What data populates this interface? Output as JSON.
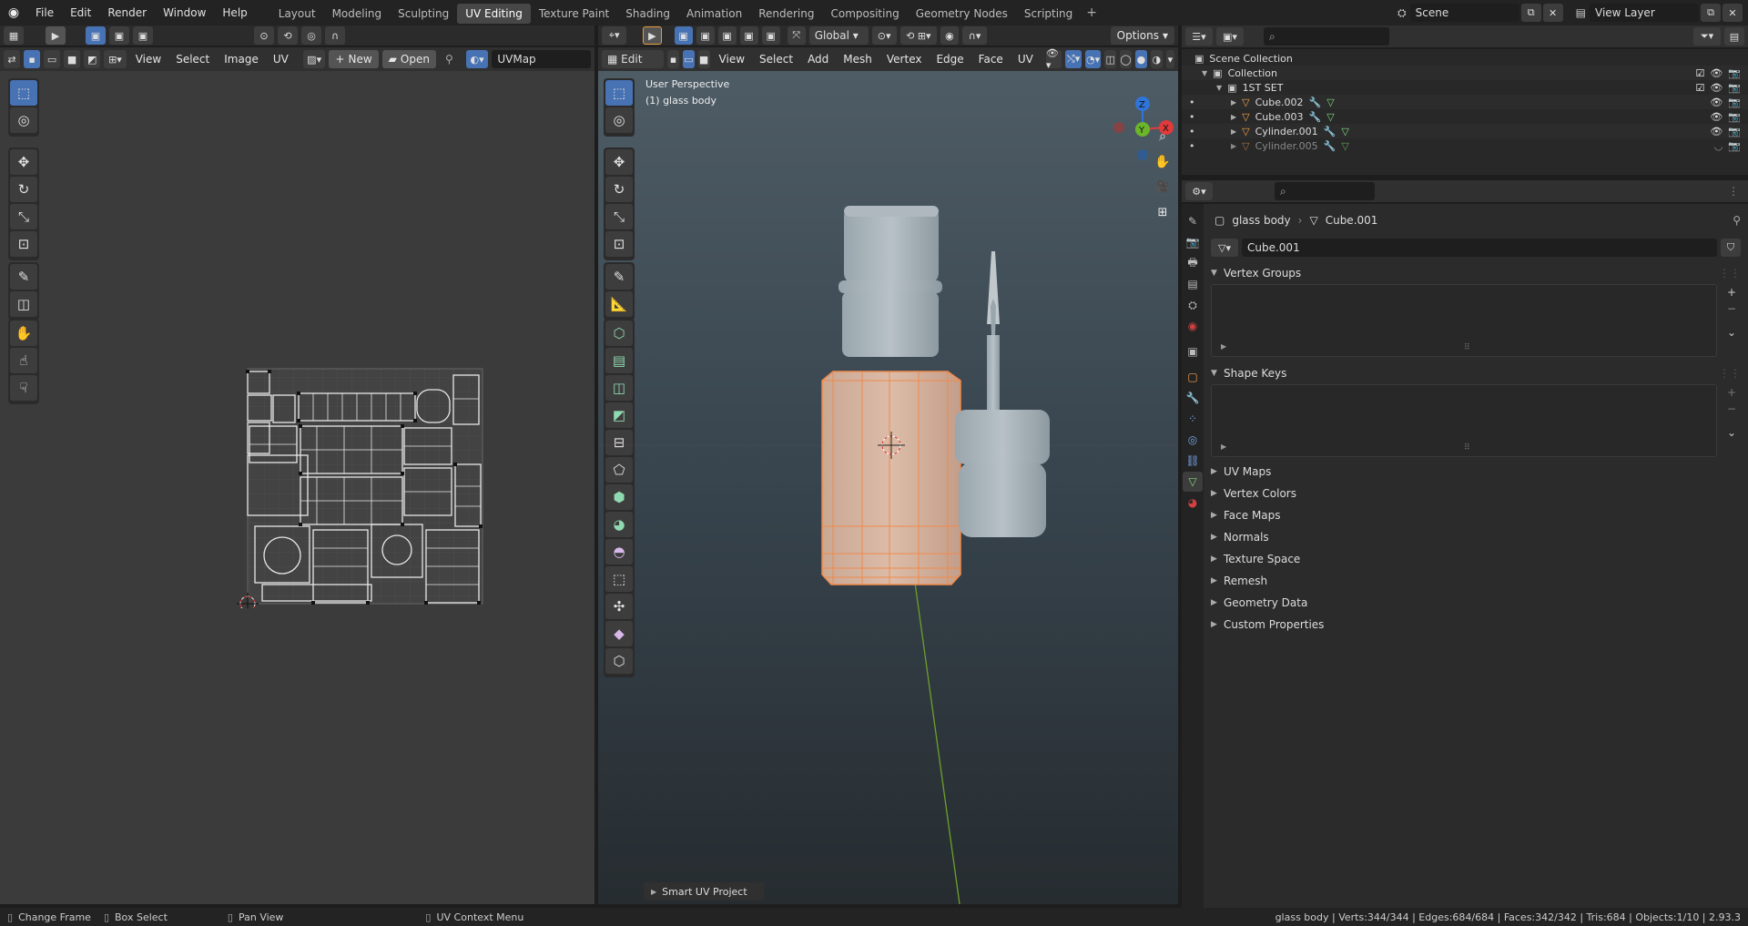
{
  "topbar": {
    "menus": [
      "File",
      "Edit",
      "Render",
      "Window",
      "Help"
    ],
    "workspaces": [
      "Layout",
      "Modeling",
      "Sculpting",
      "UV Editing",
      "Texture Paint",
      "Shading",
      "Animation",
      "Rendering",
      "Compositing",
      "Geometry Nodes",
      "Scripting"
    ],
    "active_workspace": "UV Editing",
    "scene": "Scene",
    "view_layer": "View Layer"
  },
  "uv": {
    "menus": [
      "View",
      "Select",
      "Image",
      "UV"
    ],
    "new_label": "New",
    "open_label": "Open",
    "uvmap": "UVMap"
  },
  "viewport": {
    "mode": "Edit Mode",
    "menus": [
      "View",
      "Select",
      "Add",
      "Mesh",
      "Vertex",
      "Edge",
      "Face",
      "UV"
    ],
    "orientation": "Global",
    "options_label": "Options",
    "perspective_label": "User Perspective",
    "object_label": "(1) glass body",
    "operator_panel": "Smart UV Project",
    "axis_x": "X",
    "axis_y": "Y",
    "axis_z": "Z"
  },
  "outliner": {
    "rows": [
      {
        "label": "Scene Collection"
      },
      {
        "label": "Collection"
      },
      {
        "label": "1ST SET"
      },
      {
        "label": "Cube.002"
      },
      {
        "label": "Cube.003"
      },
      {
        "label": "Cylinder.001"
      },
      {
        "label": "Cylinder.005"
      }
    ]
  },
  "properties": {
    "object_name": "glass body",
    "mesh_name": "Cube.001",
    "data_field": "Cube.001",
    "panels_open": [
      "Vertex Groups",
      "Shape Keys"
    ],
    "panels_closed": [
      "UV Maps",
      "Vertex Colors",
      "Face Maps",
      "Normals",
      "Texture Space",
      "Remesh",
      "Geometry Data",
      "Custom Properties"
    ]
  },
  "statusbar": {
    "items": [
      "Change Frame",
      "Box Select",
      "Pan View",
      "UV Context Menu"
    ],
    "stats": "glass body | Verts:344/344 | Edges:684/684 | Faces:342/342 | Tris:684 | Objects:1/10 | 2.93.3"
  },
  "colors": {
    "accent": "#4772b3",
    "selection": "#f08a4b",
    "header": "#303030"
  }
}
